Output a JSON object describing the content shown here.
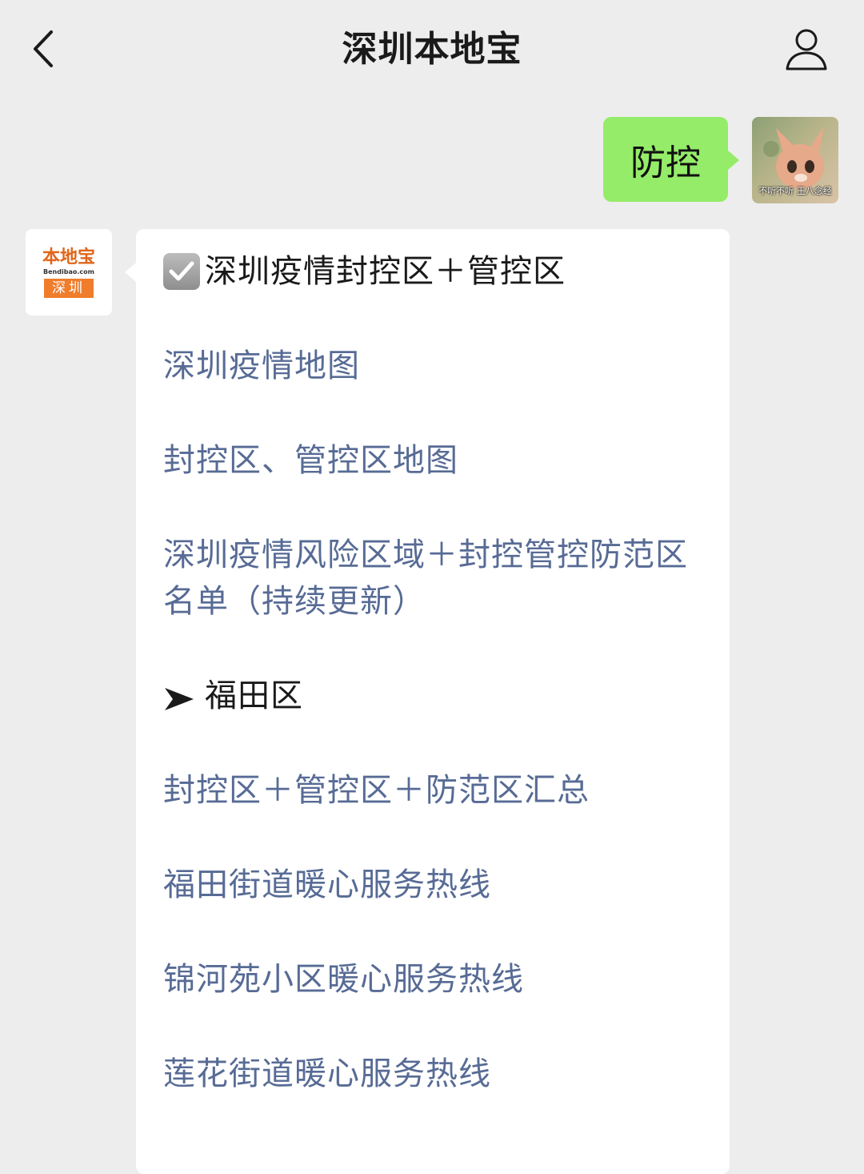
{
  "nav": {
    "title": "深圳本地宝"
  },
  "outgoing": {
    "text": "防控",
    "avatar_caption": "不听不听 王八念经"
  },
  "bot_avatar": {
    "logo_main": "本地宝",
    "logo_url": "Bendibao.com",
    "logo_city": "深圳"
  },
  "reply": {
    "heading": "深圳疫情封控区＋管控区",
    "links": [
      "深圳疫情地图",
      "封控区、管控区地图",
      "深圳疫情风险区域＋封控管控防范区名单（持续更新）"
    ],
    "subheading": "福田区",
    "district_links": [
      "封控区＋管控区＋防范区汇总",
      "福田街道暖心服务热线",
      "锦河苑小区暖心服务热线",
      "莲花街道暖心服务热线"
    ]
  },
  "colors": {
    "background": "#ededed",
    "bubble_green": "#95ec69",
    "link": "#576b95",
    "brand_orange": "#ef7d2c"
  },
  "icons": {
    "back": "chevron-left-icon",
    "profile": "person-icon",
    "check": "checkbox-checked-icon",
    "arrow": "arrowhead-right-icon"
  }
}
